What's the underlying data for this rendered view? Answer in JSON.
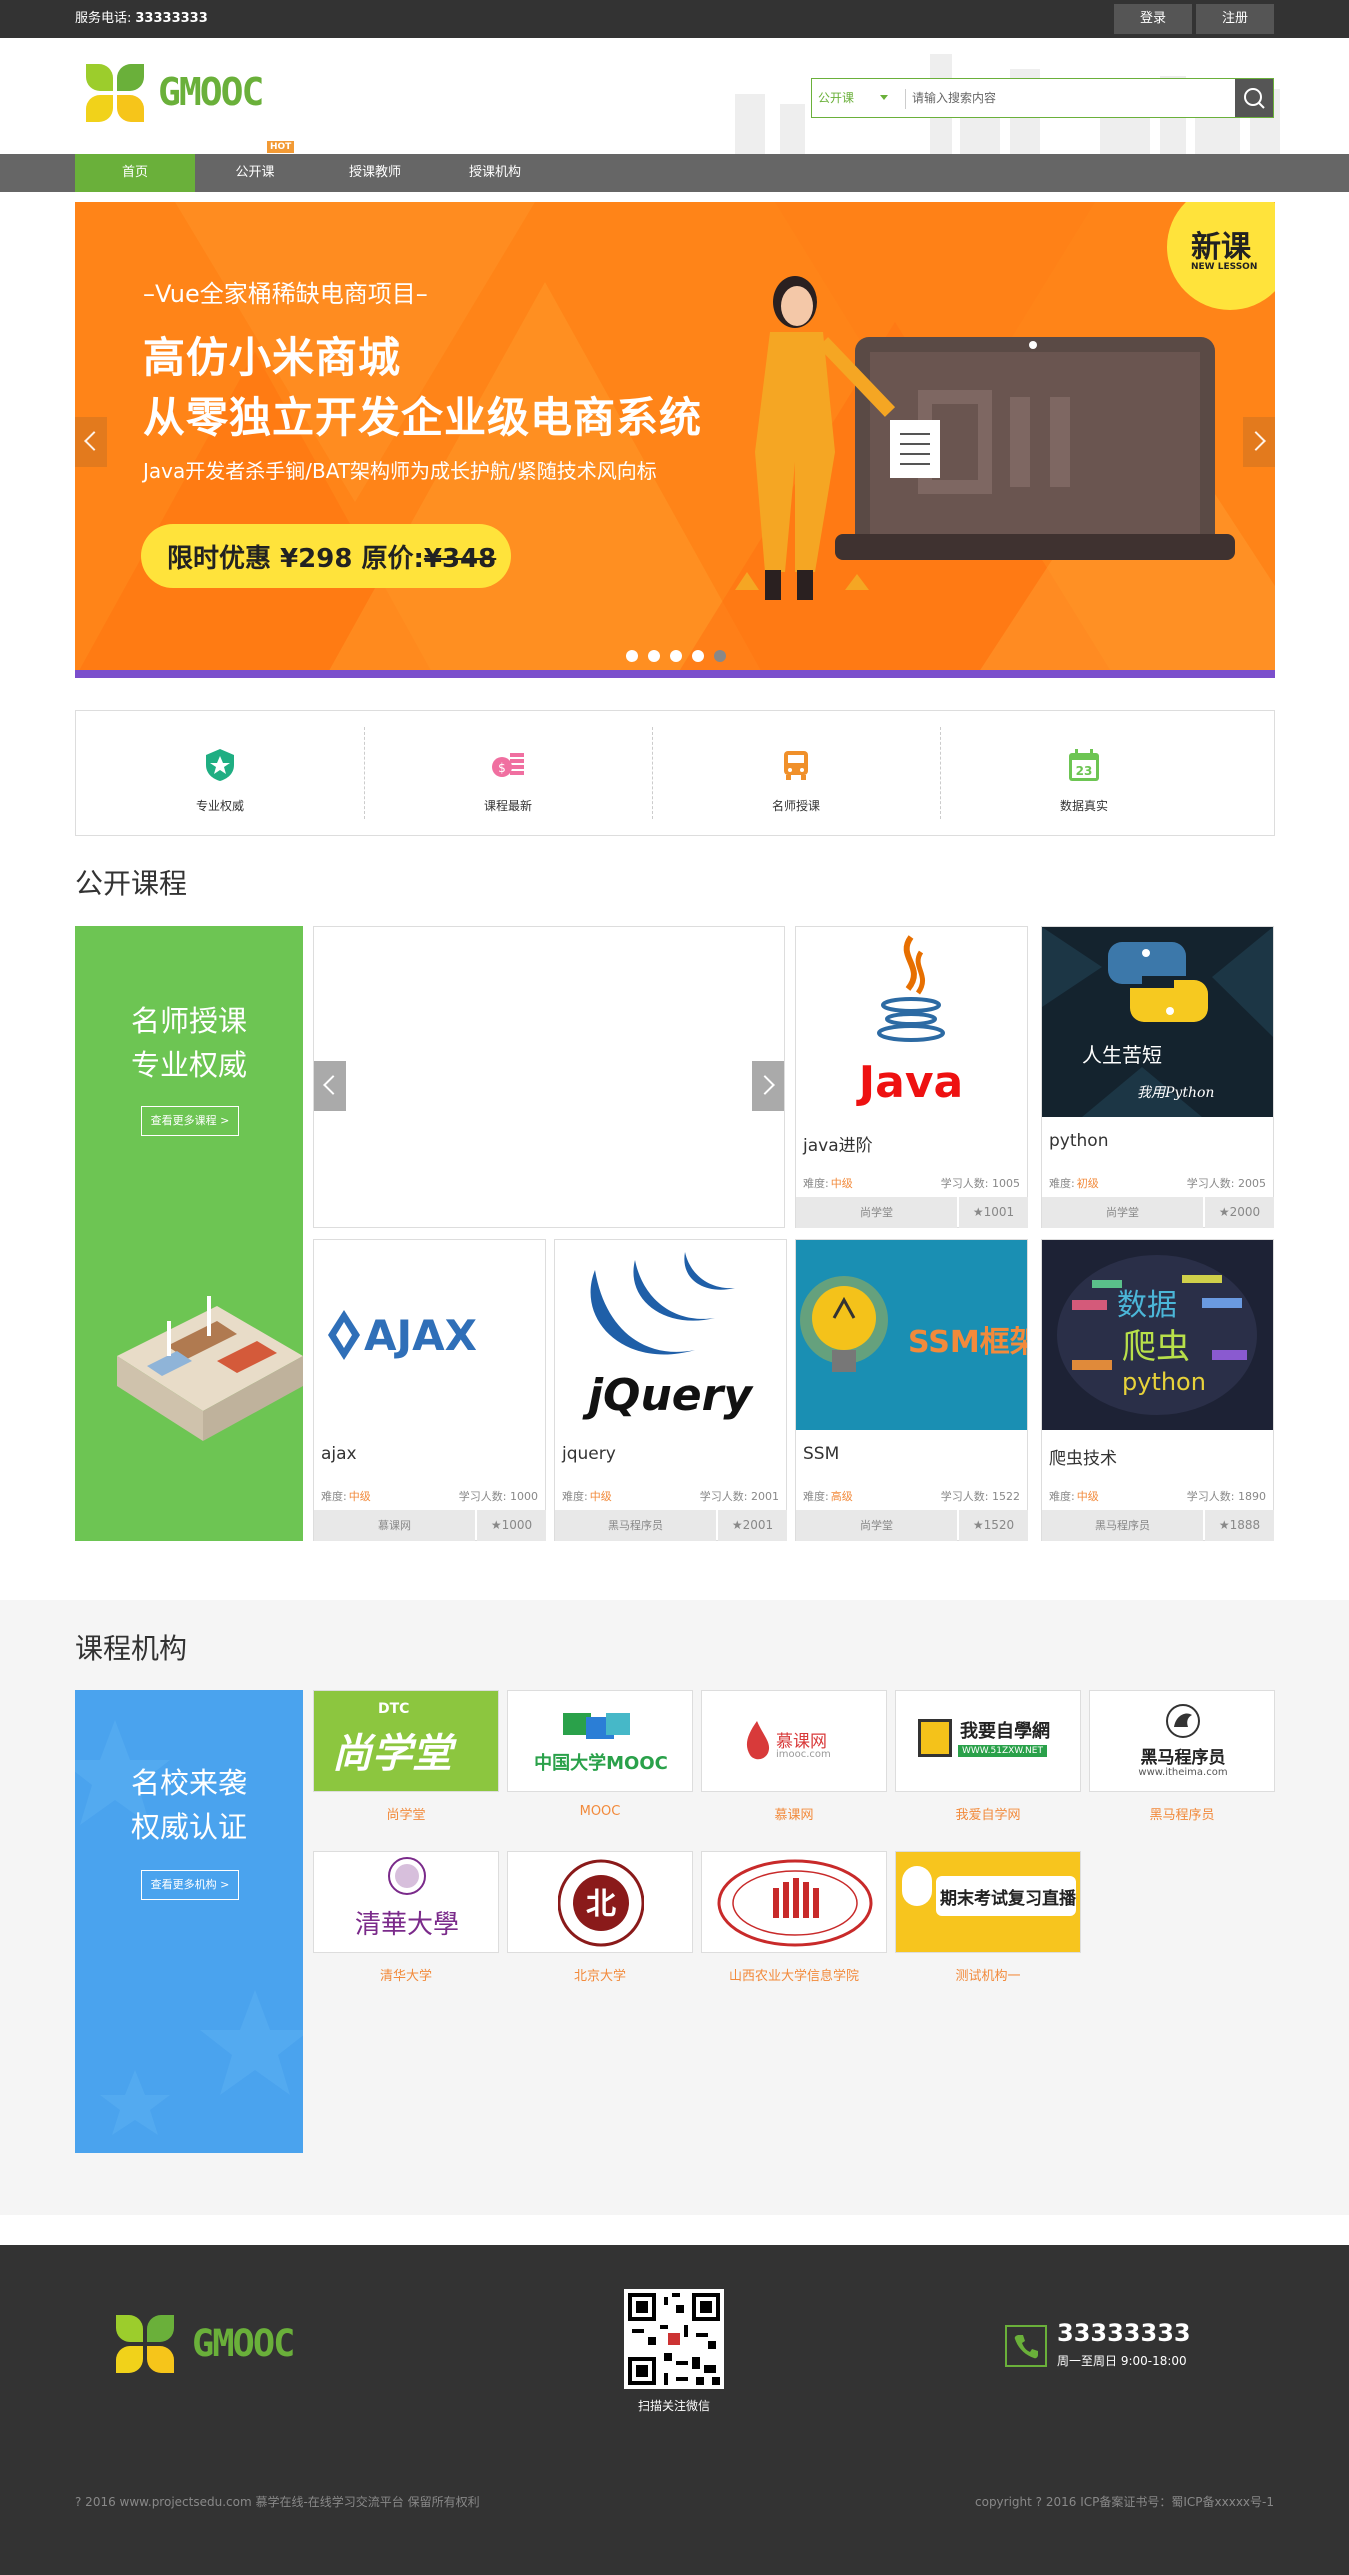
{
  "topbar": {
    "phone_label": "服务电话:",
    "phone": "33333333",
    "login": "登录",
    "register": "注册"
  },
  "header": {
    "logo_text": "GMOOC",
    "search_category": "公开课",
    "search_placeholder": "请输入搜索内容"
  },
  "nav": {
    "items": [
      "首页",
      "公开课",
      "授课教师",
      "授课机构"
    ],
    "hot_badge": "HOT"
  },
  "banner": {
    "subtitle": "–Vue全家桶稀缺电商项目–",
    "title1": "高仿小米商城",
    "title2": "从零独立开发企业级电商系统",
    "tagline": "Java开发者杀手锏/BAT架构师为成长护航/紧随技术风向标",
    "promo_prefix": "限时优惠 ¥298 原价:",
    "promo_original": "¥348",
    "badge_main": "新课",
    "badge_sub": "NEW LESSON"
  },
  "features": [
    "专业权威",
    "课程最新",
    "名师授课",
    "数据真实"
  ],
  "courses": {
    "title": "公开课程",
    "promo_line1": "名师授课",
    "promo_line2": "专业权威",
    "promo_button": "查看更多课程 >",
    "difficulty_label": "难度:",
    "students_label": "学习人数:",
    "items": [
      {
        "name": "java进阶",
        "difficulty": "中级",
        "students": "1005",
        "org": "尚学堂",
        "fav": "1001"
      },
      {
        "name": "python",
        "difficulty": "初级",
        "students": "2005",
        "org": "尚学堂",
        "fav": "2000"
      },
      {
        "name": "ajax",
        "difficulty": "中级",
        "students": "1000",
        "org": "慕课网",
        "fav": "1000"
      },
      {
        "name": "jquery",
        "difficulty": "中级",
        "students": "2001",
        "org": "黑马程序员",
        "fav": "2001"
      },
      {
        "name": "SSM",
        "difficulty": "高级",
        "students": "1522",
        "org": "尚学堂",
        "fav": "1520"
      },
      {
        "name": "爬虫技术",
        "difficulty": "中级",
        "students": "1890",
        "org": "黑马程序员",
        "fav": "1888"
      }
    ],
    "thumb_text": {
      "java": "Java",
      "python_line1": "人生苦短",
      "python_line2": "我用Python",
      "ajax": "AJAX",
      "jquery": "jQuery",
      "ssm": "SSM框架",
      "spider1": "数据",
      "spider2": "爬虫",
      "spider3": "python"
    }
  },
  "institutions": {
    "title": "课程机构",
    "promo_line1": "名校来袭",
    "promo_line2": "权威认证",
    "promo_button": "查看更多机构 >",
    "items": [
      "尚学堂",
      "MOOC",
      "慕课网",
      "我爱自学网",
      "黑马程序员",
      "清华大学",
      "北京大学",
      "山西农业大学信息学院",
      "测试机构一"
    ],
    "logo_text": {
      "sxt_small": "DTC",
      "sxt": "尚学堂",
      "mooc": "中国大学MOOC",
      "imooc": "慕课网",
      "imooc_sub": "imooc.com",
      "zixue": "我要自學網",
      "zixue_sub": "WWW.51ZXW.NET",
      "heima": "黑马程序员",
      "heima_sub": "www.itheima.com",
      "tsinghua": "清華大學",
      "pku": "北",
      "test": "期末考试复习直播"
    }
  },
  "footer": {
    "logo_text": "GMOOC",
    "qr_label": "扫描关注微信",
    "phone": "33333333",
    "hours": "周一至周日 9:00-18:00",
    "copyright_left": "? 2016 www.projectsedu.com 慕学在线-在线学习交流平台 保留所有权利",
    "copyright_right": "copyright ? 2016 ICP备案证书号：蜀ICP备xxxxx号-1"
  },
  "colors": {
    "brand_green": "#6ab03a",
    "orange": "#f28a3b",
    "blue_promo": "#4aa3ee",
    "green_promo": "#6dc553"
  }
}
